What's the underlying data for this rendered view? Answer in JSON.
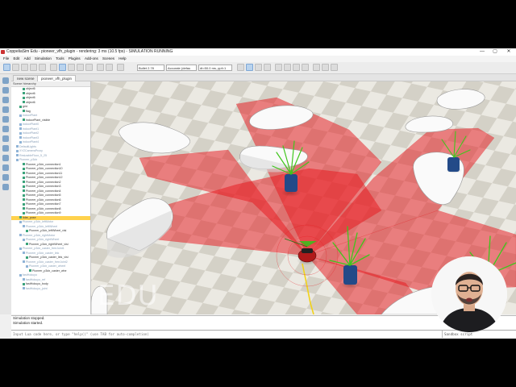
{
  "window": {
    "title": "CoppeliaSim Edu - pioneer_vfh_plugin - rendering: 3 ms (10.5 fps) - SIMULATION RUNNING",
    "controls": [
      "—",
      "▢",
      "✕"
    ]
  },
  "menu": [
    "File",
    "Edit",
    "Add",
    "Simulation",
    "Tools",
    "Plugins",
    "Add-ons",
    "Scenes",
    "Help"
  ],
  "toolbar": {
    "engine": "Bullet 2.78",
    "accuracy": "Accurate (defau",
    "timestep": "dt=50.0 ms, ppf=1"
  },
  "tabs": [
    "new scene",
    "pioneer_vfh_plugin"
  ],
  "hierarchy": {
    "header": "Scene hierarchy",
    "items": [
      {
        "label": "object6",
        "indent": 3,
        "selected": false,
        "dim": false
      },
      {
        "label": "object6",
        "indent": 3,
        "selected": false,
        "dim": false
      },
      {
        "label": "object6",
        "indent": 3,
        "selected": false,
        "dim": false
      },
      {
        "label": "object6",
        "indent": 3,
        "selected": false,
        "dim": false
      },
      {
        "label": "grid",
        "indent": 2,
        "selected": false,
        "dim": false
      },
      {
        "label": "flag",
        "indent": 3,
        "selected": false,
        "dim": false
      },
      {
        "label": "indoorPlant",
        "indent": 2,
        "selected": false,
        "dim": true
      },
      {
        "label": "indoorPlant_visible",
        "indent": 3,
        "selected": false,
        "dim": false
      },
      {
        "label": "indoorPlant0",
        "indent": 2,
        "selected": false,
        "dim": true
      },
      {
        "label": "indoorPlant1",
        "indent": 2,
        "selected": false,
        "dim": true
      },
      {
        "label": "indoorPlant2",
        "indent": 2,
        "selected": false,
        "dim": true
      },
      {
        "label": "indoorPlant3",
        "indent": 2,
        "selected": false,
        "dim": true
      },
      {
        "label": "indoorPlant4",
        "indent": 2,
        "selected": false,
        "dim": true
      },
      {
        "label": "DefaultLights",
        "indent": 1,
        "selected": false,
        "dim": true
      },
      {
        "label": "XYZCameraProxy",
        "indent": 1,
        "selected": false,
        "dim": true
      },
      {
        "label": "ResizableFloor_5_25",
        "indent": 1,
        "selected": false,
        "dim": true
      },
      {
        "label": "Pioneer_p3dx",
        "indent": 1,
        "selected": false,
        "dim": true
      },
      {
        "label": "Pioneer_p3dx_connection1",
        "indent": 3,
        "selected": false,
        "dim": false
      },
      {
        "label": "Pioneer_p3dx_connection10",
        "indent": 3,
        "selected": false,
        "dim": false
      },
      {
        "label": "Pioneer_p3dx_connection11",
        "indent": 3,
        "selected": false,
        "dim": false
      },
      {
        "label": "Pioneer_p3dx_connection12",
        "indent": 3,
        "selected": false,
        "dim": false
      },
      {
        "label": "Pioneer_p3dx_connection2",
        "indent": 3,
        "selected": false,
        "dim": false
      },
      {
        "label": "Pioneer_p3dx_connection3",
        "indent": 3,
        "selected": false,
        "dim": false
      },
      {
        "label": "Pioneer_p3dx_connection4",
        "indent": 3,
        "selected": false,
        "dim": false
      },
      {
        "label": "Pioneer_p3dx_connection5",
        "indent": 3,
        "selected": false,
        "dim": false
      },
      {
        "label": "Pioneer_p3dx_connection6",
        "indent": 3,
        "selected": false,
        "dim": false
      },
      {
        "label": "Pioneer_p3dx_connection7",
        "indent": 3,
        "selected": false,
        "dim": false
      },
      {
        "label": "Pioneer_p3dx_connection8",
        "indent": 3,
        "selected": false,
        "dim": false
      },
      {
        "label": "Pioneer_p3dx_connection9",
        "indent": 3,
        "selected": false,
        "dim": false
      },
      {
        "label": "lidar_pose",
        "indent": 2,
        "selected": true,
        "dim": false
      },
      {
        "label": "Pioneer_p3dx_leftMotor",
        "indent": 2,
        "selected": false,
        "dim": true
      },
      {
        "label": "Pioneer_p3dx_leftWheel",
        "indent": 3,
        "selected": false,
        "dim": true
      },
      {
        "label": "Pioneer_p3dx_leftWheel_visi",
        "indent": 4,
        "selected": false,
        "dim": false
      },
      {
        "label": "Pioneer_p3dx_rightMotor",
        "indent": 2,
        "selected": false,
        "dim": true
      },
      {
        "label": "Pioneer_p3dx_rightWheel",
        "indent": 3,
        "selected": false,
        "dim": true
      },
      {
        "label": "Pioneer_p3dx_rightWheel_visi",
        "indent": 4,
        "selected": false,
        "dim": false
      },
      {
        "label": "Pioneer_p3dx_caster_freeJoint1",
        "indent": 2,
        "selected": false,
        "dim": true
      },
      {
        "label": "Pioneer_p3dx_caster_link",
        "indent": 3,
        "selected": false,
        "dim": true
      },
      {
        "label": "Pioneer_p3dx_caster_link_visi",
        "indent": 4,
        "selected": false,
        "dim": false
      },
      {
        "label": "Pioneer_p3dx_caster_freeJoint2",
        "indent": 3,
        "selected": false,
        "dim": true
      },
      {
        "label": "Pioneer_p3dx_caster_wheel",
        "indent": 4,
        "selected": false,
        "dim": true
      },
      {
        "label": "Pioneer_p3dx_caster_whe",
        "indent": 5,
        "selected": false,
        "dim": false
      },
      {
        "label": "fastHokuyo",
        "indent": 2,
        "selected": false,
        "dim": true
      },
      {
        "label": "fastHokuyo_ref",
        "indent": 3,
        "selected": false,
        "dim": true
      },
      {
        "label": "fastHokuyo_body",
        "indent": 3,
        "selected": false,
        "dim": false
      },
      {
        "label": "fastHokuyo_joint",
        "indent": 3,
        "selected": false,
        "dim": true
      }
    ]
  },
  "viewport": {
    "watermark": "EDU"
  },
  "status": [
    "Simulation stopped.",
    "Simulation started."
  ],
  "command": {
    "placeholder": "Input Lua code here, or type \"help()\" (use TAB for auto-completion)",
    "sandbox": "Sandbox script"
  },
  "colors": {
    "laser": "#e8141a",
    "floor_light": "#e9e6de",
    "floor_dark": "#c8c4b8",
    "obstacle": "#fafafa",
    "selection": "#ffd24d"
  }
}
